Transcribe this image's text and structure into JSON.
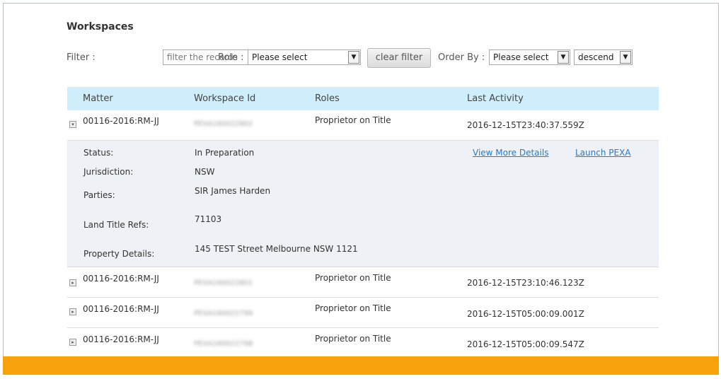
{
  "page": {
    "title": "Workspaces"
  },
  "filters": {
    "filter_label": "Filter :",
    "filter_placeholder": "filter the records",
    "role_label": "Role :",
    "role_selected": "Please select",
    "clear_filter_label": "clear filter",
    "order_by_label": "Order By :",
    "order_by_selected": "Please select",
    "direction_selected": "descend"
  },
  "table": {
    "columns": [
      "Matter",
      "Workspace Id",
      "Roles",
      "Last Activity"
    ],
    "rows": [
      {
        "matter": "00116-2016:RM-JJ",
        "workspace_id": "PEXA160022802",
        "role": "Proprietor on Title",
        "last_activity": "2016-12-15T23:40:37.559Z",
        "expanded": true
      },
      {
        "matter": "00116-2016:RM-JJ",
        "workspace_id": "PEXA160022801",
        "role": "Proprietor on Title",
        "last_activity": "2016-12-15T23:10:46.123Z",
        "expanded": false
      },
      {
        "matter": "00116-2016:RM-JJ",
        "workspace_id": "PEXA160022799",
        "role": "Proprietor on Title",
        "last_activity": "2016-12-15T05:00:09.001Z",
        "expanded": false
      },
      {
        "matter": "00116-2016:RM-JJ",
        "workspace_id": "PEXA160022798",
        "role": "Proprietor on Title",
        "last_activity": "2016-12-15T05:00:09.547Z",
        "expanded": false
      }
    ]
  },
  "details": {
    "status_label": "Status:",
    "status_value": "In Preparation",
    "jurisdiction_label": "Jurisdiction:",
    "jurisdiction_value": "NSW",
    "parties_label": "Parties:",
    "parties_value": "SIR James Harden",
    "land_title_label": "Land Title Refs:",
    "land_title_value": "71103",
    "property_label": "Property Details:",
    "property_value": "145 TEST Street Melbourne NSW 1121",
    "view_more_label": "View More Details",
    "launch_label": "Launch PEXA"
  },
  "colors": {
    "header_bg": "#cfeefb",
    "details_bg": "#eef1f5",
    "link": "#2a79c4",
    "footer_bar": "#f7a20a"
  },
  "icons": {
    "expanded_toggle": "chevron-down-icon",
    "collapsed_toggle": "chevron-right-icon",
    "select_arrow": "chevron-down-icon"
  }
}
